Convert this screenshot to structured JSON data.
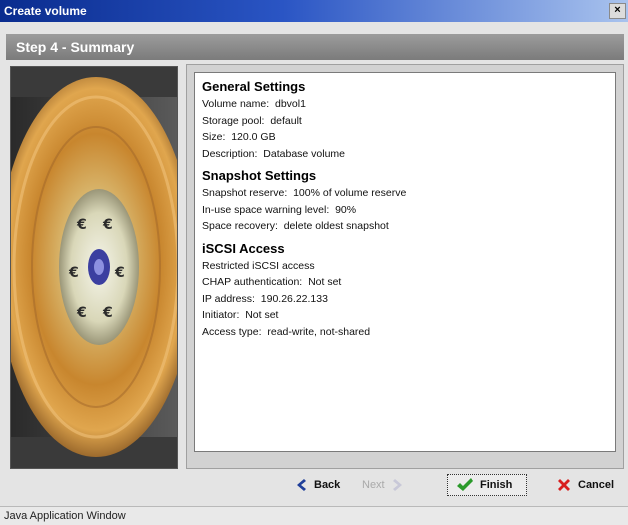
{
  "window": {
    "title": "Create volume",
    "close_glyph": "×"
  },
  "step": {
    "title": "Step 4 - Summary"
  },
  "image": {
    "icon": "hard-drive-platter-image"
  },
  "summary": {
    "general": {
      "heading": "General Settings",
      "volume_name_label": "Volume name",
      "volume_name_value": "dbvol1",
      "storage_pool_label": "Storage pool",
      "storage_pool_value": "default",
      "size_label": "Size",
      "size_value": "120.0 GB",
      "description_label": "Description",
      "description_value": "Database volume"
    },
    "snapshot": {
      "heading": "Snapshot Settings",
      "reserve_label": "Snapshot reserve",
      "reserve_value": "100% of volume reserve",
      "warning_label": "In-use space warning level",
      "warning_value": "90%",
      "recovery_label": "Space recovery",
      "recovery_value": "delete oldest snapshot"
    },
    "iscsi": {
      "heading": "iSCSI Access",
      "restricted_text": "Restricted iSCSI access",
      "chap_label": "CHAP authentication",
      "chap_value": "Not set",
      "ip_label": "IP address",
      "ip_value": "190.26.22.133",
      "initiator_label": "Initiator",
      "initiator_value": "Not set",
      "access_label": "Access type",
      "access_value": "read-write, not-shared"
    }
  },
  "buttons": {
    "back": "Back",
    "next": "Next",
    "finish": "Finish",
    "cancel": "Cancel"
  },
  "statusbar": {
    "text": "Java Application Window"
  },
  "colors": {
    "titlebar": "#0a2c8e",
    "stepbar": "#8a8a8a",
    "finish_check": "#2a9a2a",
    "cancel_x": "#d81e1e",
    "nav_arrow": "#1f3f9a"
  }
}
